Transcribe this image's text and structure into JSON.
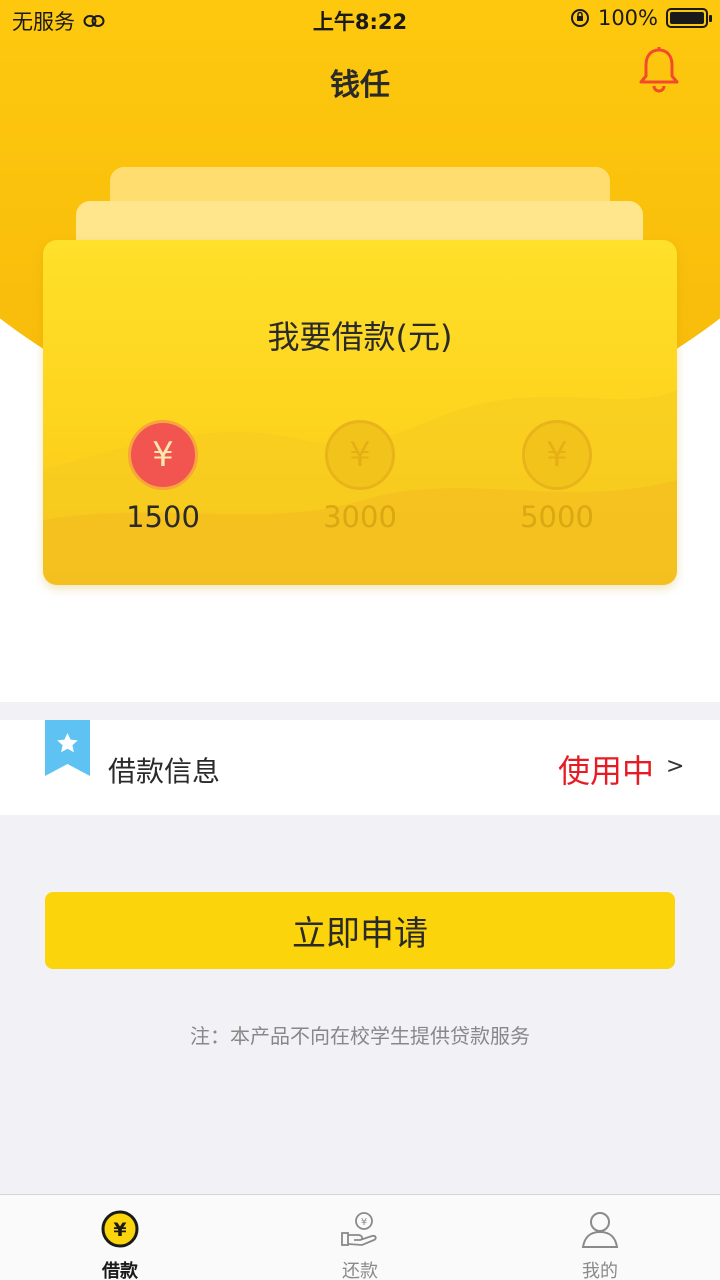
{
  "status_bar": {
    "carrier": "无服务",
    "time": "上午8:22",
    "battery": "100%"
  },
  "header": {
    "title": "钱任"
  },
  "loan_card": {
    "title": "我要借款(元)",
    "coin_symbol": "¥",
    "amounts": [
      "1500",
      "3000",
      "5000"
    ],
    "selected": "1500"
  },
  "loan_info": {
    "label": "借款信息",
    "status": "使用中",
    "arrow": ">"
  },
  "apply_button": {
    "label": "立即申请"
  },
  "note": "注：本产品不向在校学生提供贷款服务",
  "tabbar": {
    "tabs": [
      {
        "label": "借款",
        "active": true
      },
      {
        "label": "还款",
        "active": false
      },
      {
        "label": "我的",
        "active": false
      }
    ]
  },
  "colors": {
    "brand_yellow": "#fbd40c",
    "status_red": "#e51c23",
    "coin_active": "#f25550",
    "ribbon_blue": "#5ec3f2"
  }
}
